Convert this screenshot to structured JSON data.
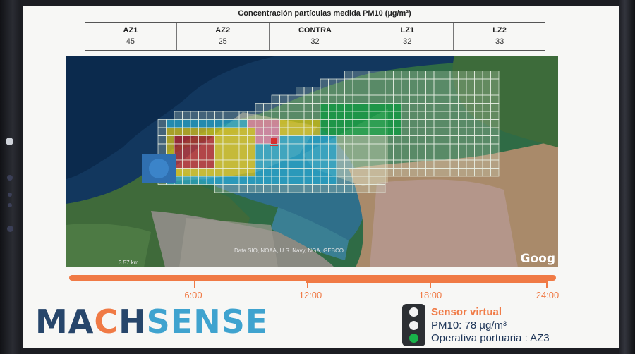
{
  "table": {
    "title": "Concentración partículas medida PM10 (µg/m³)",
    "columns": [
      {
        "header": "AZ1",
        "value": "45"
      },
      {
        "header": "AZ2",
        "value": "25"
      },
      {
        "header": "CONTRA",
        "value": "32"
      },
      {
        "header": "LZ1",
        "value": "32"
      },
      {
        "header": "LZ2",
        "value": "33"
      }
    ]
  },
  "map": {
    "attribution": "Data SIO, NOAA, U.S. Navy, NGA, GEBCO",
    "scale": "3.57 km",
    "provider_logo": "Goog"
  },
  "timeline": {
    "labels": [
      "6:00",
      "12:00",
      "18:00",
      "24:00"
    ]
  },
  "logo": {
    "part1": "MA",
    "part2": "C",
    "part3": "H",
    "part4": "SENSE"
  },
  "sensor": {
    "title": "Sensor virtual",
    "value_line": "PM10: 78 µg/m³",
    "status_line": "Operativa portuaria : AZ3",
    "active_light": "green"
  },
  "colors": {
    "accent": "#f07a45",
    "brand_dark": "#27466b",
    "brand_light": "#3fa3cf",
    "grid_green": "#1aa34a",
    "grid_yellow": "#d9c31a",
    "grid_red": "#c0282c"
  }
}
